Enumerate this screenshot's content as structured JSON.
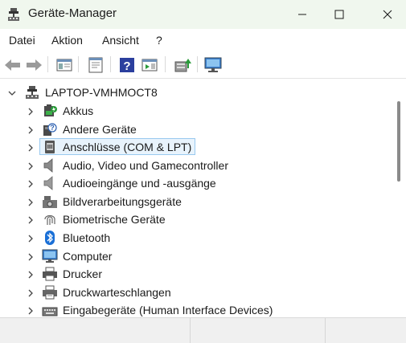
{
  "window": {
    "title": "Geräte-Manager"
  },
  "menubar": {
    "items": [
      {
        "label": "Datei"
      },
      {
        "label": "Aktion"
      },
      {
        "label": "Ansicht"
      },
      {
        "label": "?"
      }
    ]
  },
  "toolbar": {
    "buttons": [
      {
        "icon": "back-arrow-icon"
      },
      {
        "icon": "forward-arrow-icon"
      },
      {
        "icon": "show-hide-console-tree-icon"
      },
      {
        "icon": "properties-icon"
      },
      {
        "icon": "help-icon"
      },
      {
        "icon": "action-pane-icon"
      },
      {
        "icon": "update-driver-icon"
      },
      {
        "icon": "scan-hardware-icon"
      }
    ]
  },
  "tree": {
    "root": {
      "label": "LAPTOP-VMHMOCT8",
      "icon": "computer-tree-icon",
      "expanded": true
    },
    "items": [
      {
        "label": "Akkus",
        "icon": "battery-icon"
      },
      {
        "label": "Andere Geräte",
        "icon": "unknown-device-icon"
      },
      {
        "label": "Anschlüsse (COM & LPT)",
        "icon": "port-icon",
        "selected": true
      },
      {
        "label": "Audio, Video und Gamecontroller",
        "icon": "speaker-icon"
      },
      {
        "label": "Audioeingänge und -ausgänge",
        "icon": "audio-io-icon"
      },
      {
        "label": "Bildverarbeitungsgeräte",
        "icon": "camera-icon"
      },
      {
        "label": "Biometrische Geräte",
        "icon": "fingerprint-icon"
      },
      {
        "label": "Bluetooth",
        "icon": "bluetooth-icon"
      },
      {
        "label": "Computer",
        "icon": "computer-icon"
      },
      {
        "label": "Drucker",
        "icon": "printer-icon"
      },
      {
        "label": "Druckwarteschlangen",
        "icon": "print-queue-icon"
      },
      {
        "label": "Eingabegeräte (Human Interface Devices)",
        "icon": "hid-icon"
      }
    ]
  },
  "colors": {
    "titlebar_bg": "#f0f7ee",
    "selection_bg": "#e8f3fc",
    "selection_border": "#99c9ef",
    "bluetooth_blue": "#1a6fd6"
  }
}
